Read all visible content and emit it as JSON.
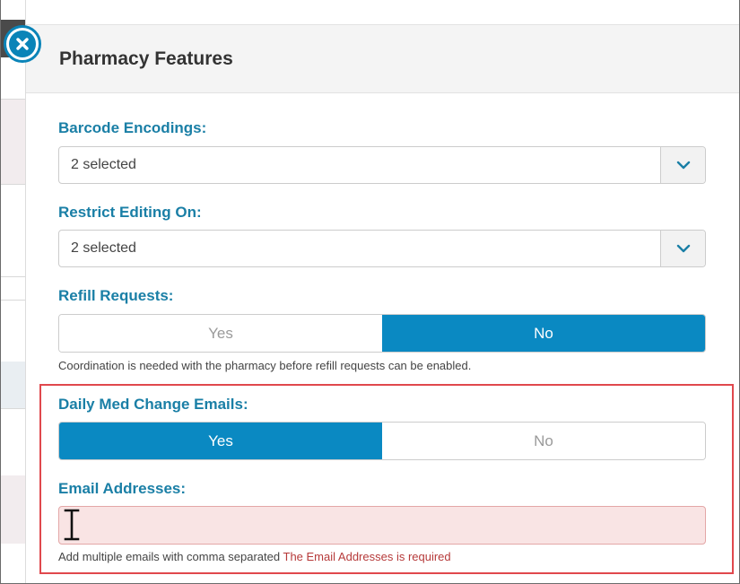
{
  "modal": {
    "title": "Pharmacy Features"
  },
  "barcode_encodings": {
    "label": "Barcode Encodings:",
    "value": "2 selected"
  },
  "restrict_editing": {
    "label": "Restrict Editing On:",
    "value": "2 selected"
  },
  "refill_requests": {
    "label": "Refill Requests:",
    "options": [
      "Yes",
      "No"
    ],
    "selected": "No",
    "help": "Coordination is needed with the pharmacy before refill requests can be enabled."
  },
  "daily_med": {
    "label": "Daily Med Change Emails:",
    "options": [
      "Yes",
      "No"
    ],
    "selected": "Yes"
  },
  "email_addresses": {
    "label": "Email Addresses:",
    "value": "",
    "help": "Add multiple emails with comma separated",
    "error": "The Email Addresses is required"
  },
  "icons": {
    "close": "close-circle-icon",
    "caret": "chevron-down-icon",
    "cursor": "text-cursor-icon"
  },
  "colors": {
    "accent": "#0a89c2",
    "label": "#1a7fa6",
    "error": "#b63a3a",
    "highlight": "#e0484d"
  }
}
